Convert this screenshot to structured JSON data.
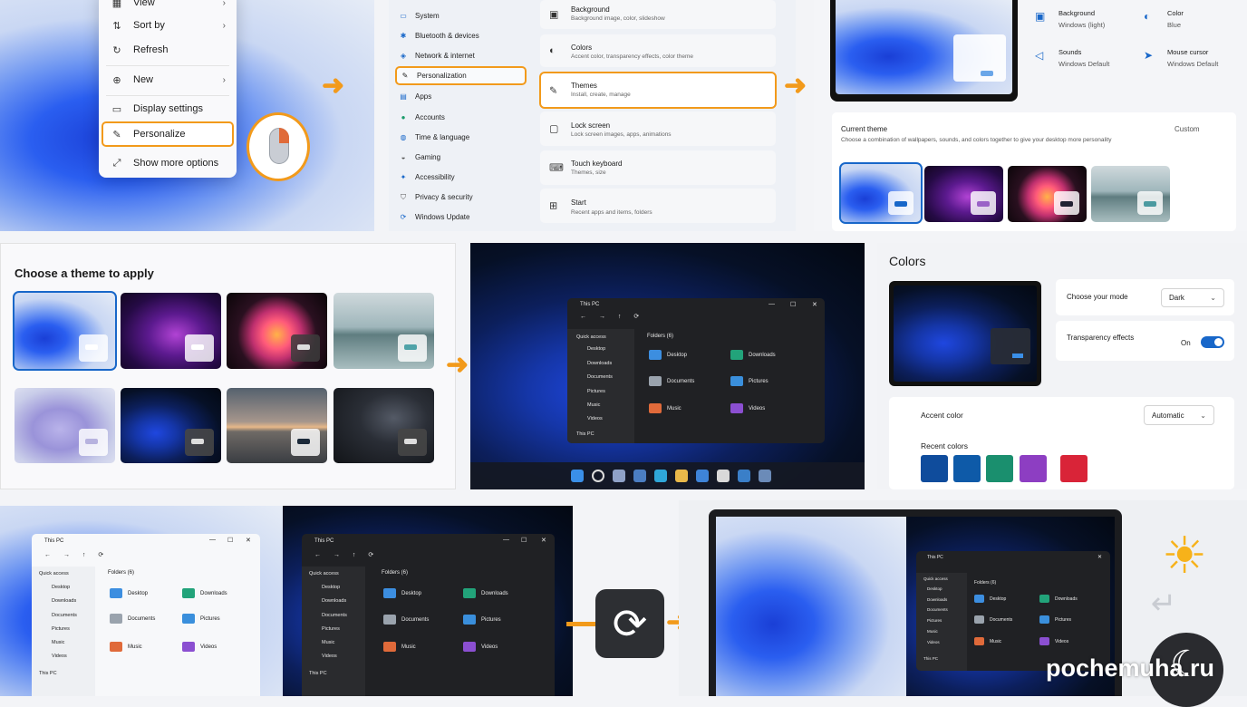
{
  "context_menu": {
    "items": [
      {
        "label": "View",
        "icon": "grid-icon",
        "submenu": true
      },
      {
        "label": "Sort by",
        "icon": "sort-icon",
        "submenu": true
      },
      {
        "label": "Refresh",
        "icon": "refresh-icon",
        "submenu": false
      },
      {
        "label": "New",
        "icon": "plus-circle-icon",
        "submenu": true
      },
      {
        "label": "Display settings",
        "icon": "monitor-icon",
        "submenu": false
      },
      {
        "label": "Personalize",
        "icon": "pencil-icon",
        "submenu": false,
        "highlighted": true
      },
      {
        "label": "Show more options",
        "icon": "expand-icon",
        "submenu": false
      }
    ]
  },
  "settings_nav": {
    "items": [
      {
        "label": "System",
        "icon": "monitor-icon"
      },
      {
        "label": "Bluetooth & devices",
        "icon": "bluetooth-icon"
      },
      {
        "label": "Network & internet",
        "icon": "wifi-icon"
      },
      {
        "label": "Personalization",
        "icon": "pencil-icon",
        "selected": true
      },
      {
        "label": "Apps",
        "icon": "apps-icon"
      },
      {
        "label": "Accounts",
        "icon": "person-icon"
      },
      {
        "label": "Time & language",
        "icon": "globe-icon"
      },
      {
        "label": "Gaming",
        "icon": "gamepad-icon"
      },
      {
        "label": "Accessibility",
        "icon": "accessibility-icon"
      },
      {
        "label": "Privacy & security",
        "icon": "shield-icon"
      },
      {
        "label": "Windows Update",
        "icon": "update-icon"
      }
    ]
  },
  "personalization_cards": [
    {
      "title": "Background",
      "subtitle": "Background image, color, slideshow",
      "icon": "image-icon"
    },
    {
      "title": "Colors",
      "subtitle": "Accent color, transparency effects, color theme",
      "icon": "palette-icon"
    },
    {
      "title": "Themes",
      "subtitle": "Install, create, manage",
      "icon": "brush-icon",
      "highlighted": true
    },
    {
      "title": "Lock screen",
      "subtitle": "Lock screen images, apps, animations",
      "icon": "lock-screen-icon"
    },
    {
      "title": "Touch keyboard",
      "subtitle": "Themes, size",
      "icon": "keyboard-icon"
    },
    {
      "title": "Start",
      "subtitle": "Recent apps and items, folders",
      "icon": "start-grid-icon"
    }
  ],
  "themes_page": {
    "properties": [
      {
        "title": "Background",
        "value": "Windows (light)",
        "icon": "image-icon"
      },
      {
        "title": "Color",
        "value": "Blue",
        "icon": "palette-icon"
      },
      {
        "title": "Sounds",
        "value": "Windows Default",
        "icon": "speaker-icon"
      },
      {
        "title": "Mouse cursor",
        "value": "Windows Default",
        "icon": "cursor-icon"
      }
    ],
    "current_theme_label": "Current theme",
    "current_theme_desc": "Choose a combination of wallpapers, sounds, and colors together to give your desktop more personality",
    "current_theme_value": "Custom"
  },
  "theme_picker": {
    "title": "Choose a theme to apply"
  },
  "explorer": {
    "title": "This PC",
    "quick_access": "Quick access",
    "side_items": [
      "Desktop",
      "Downloads",
      "Documents",
      "Pictures",
      "Music",
      "Videos"
    ],
    "this_pc": "This PC",
    "folders_header": "Folders (6)",
    "folders": [
      "Desktop",
      "Downloads",
      "Documents",
      "Pictures",
      "Music",
      "Videos"
    ]
  },
  "colors_page": {
    "title": "Colors",
    "mode_label": "Choose your mode",
    "mode_value": "Dark",
    "transparency_label": "Transparency effects",
    "transparency_value": "On",
    "accent_label": "Accent color",
    "accent_value": "Automatic",
    "recent_label": "Recent colors",
    "recent_colors": [
      "#0f4c9c",
      "#0e5aa8",
      "#1a8f6e",
      "#8d3ec2",
      "#d92438"
    ]
  },
  "watermark": "pochemuha.ru",
  "colors": {
    "accent": "#f29a1b",
    "blue": "#1867c9"
  }
}
